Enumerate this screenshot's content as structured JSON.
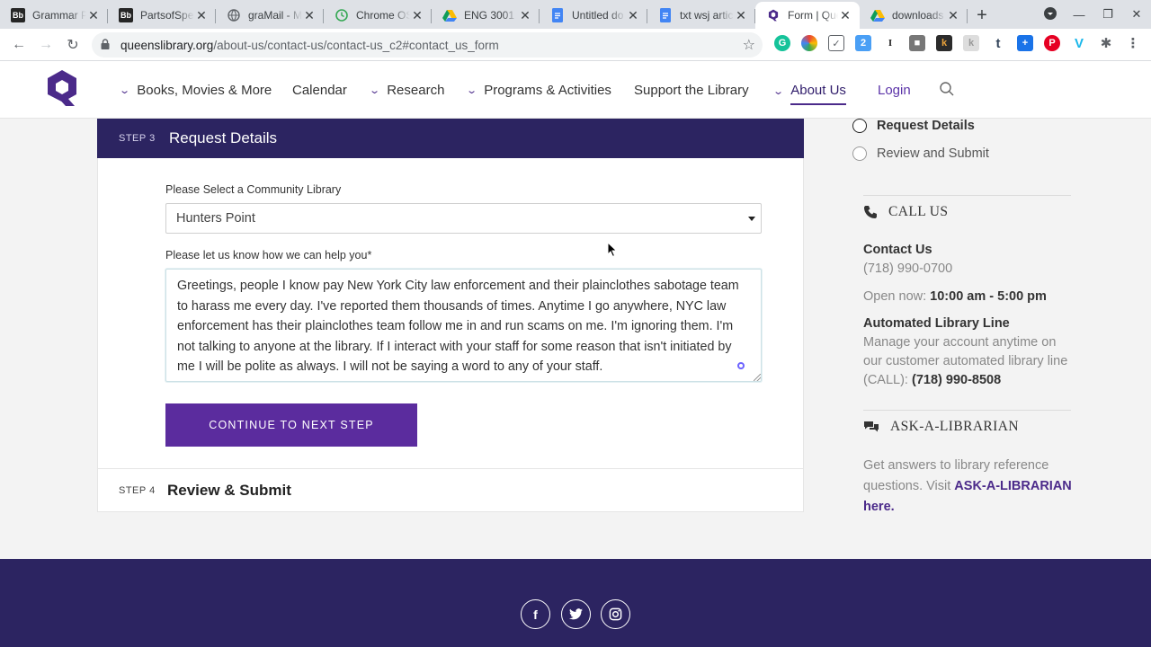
{
  "browser": {
    "tabs": [
      {
        "title": "Grammar P",
        "icon": "bb-icon",
        "color": "#262626",
        "glyph": "Bb"
      },
      {
        "title": "PartsofSpe",
        "icon": "bb-icon",
        "color": "#262626",
        "glyph": "Bb"
      },
      {
        "title": "graMail - M",
        "icon": "globe-icon",
        "color": "#5f6368",
        "glyph": ""
      },
      {
        "title": "Chrome OS",
        "icon": "clock-icon",
        "color": "#34a853",
        "glyph": ""
      },
      {
        "title": "ENG 3001 -",
        "icon": "drive-icon",
        "color": "#fbbc04",
        "glyph": ""
      },
      {
        "title": "Untitled do",
        "icon": "docs-icon",
        "color": "#4285f4",
        "glyph": ""
      },
      {
        "title": "txt wsj artic",
        "icon": "docs-icon",
        "color": "#4285f4",
        "glyph": ""
      },
      {
        "title": "Form | Que",
        "icon": "qpl-icon",
        "color": "#4b2a8a",
        "glyph": "Q",
        "active": true
      },
      {
        "title": "downloads",
        "icon": "drive-icon",
        "color": "#fbbc04",
        "glyph": ""
      }
    ],
    "url_host": "queenslibrary.org",
    "url_path": "/about-us/contact-us/contact-us_c2#contact_us_form"
  },
  "nav": {
    "items": [
      {
        "label": "Books, Movies & More",
        "dropdown": true
      },
      {
        "label": "Calendar",
        "dropdown": false
      },
      {
        "label": "Research",
        "dropdown": true
      },
      {
        "label": "Programs & Activities",
        "dropdown": true
      },
      {
        "label": "Support the Library",
        "dropdown": false
      },
      {
        "label": "About Us",
        "dropdown": true,
        "active": true
      },
      {
        "label": "Login",
        "dropdown": false
      }
    ]
  },
  "form": {
    "step3_label": "STEP 3",
    "step3_title": "Request Details",
    "library_label": "Please Select a Community Library",
    "library_value": "Hunters Point",
    "help_label": "Please let us know how we can help you*",
    "help_value": "Greetings, people I know pay New York City law enforcement and their plainclothes sabotage team to harass me every day. I've reported them thousands of times. Anytime I go anywhere, NYC law enforcement has their plainclothes team follow me in and run scams on me. I'm ignoring them. I'm not talking to anyone at the library. If I interact with your staff for some reason that isn't initiated by me I will be polite as always. I will not be saying a word to any of your staff.",
    "continue_label": "CONTINUE TO NEXT STEP",
    "step4_label": "STEP 4",
    "step4_title": "Review & Submit"
  },
  "sidebar": {
    "progress": [
      {
        "label": "Request Details",
        "current": true
      },
      {
        "label": "Review and Submit",
        "current": false
      }
    ],
    "call_heading": "CALL US",
    "contact_title": "Contact Us",
    "contact_phone": "(718) 990-0700",
    "open_label": "Open now:",
    "open_hours": "10:00 am - 5:00 pm",
    "auto_title": "Automated Library Line",
    "auto_text": "Manage your account anytime on our customer automated library line (CALL):",
    "auto_phone": "(718) 990-8508",
    "ask_heading": "ASK-A-LIBRARIAN",
    "ask_text": "Get answers to library reference questions. Visit",
    "ask_link": "ASK-A-LIBRARIAN here."
  },
  "footer": {
    "social": [
      {
        "name": "facebook-icon",
        "glyph": "f"
      },
      {
        "name": "twitter-icon",
        "glyph": ""
      },
      {
        "name": "instagram-icon",
        "glyph": ""
      }
    ]
  },
  "colors": {
    "brand_dark": "#2c2461",
    "brand_purple": "#5b2c9e"
  }
}
